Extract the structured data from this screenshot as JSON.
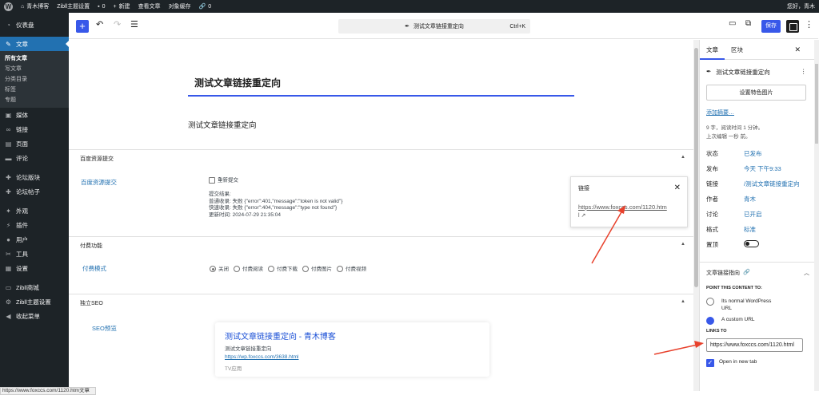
{
  "adminbar": {
    "site": "青木博客",
    "zibll_settings": "Zibll主题设置",
    "comments": "0",
    "new": "新建",
    "view": "查看文章",
    "cache": "对象缓存",
    "links_count": "0",
    "greeting": "您好，青木"
  },
  "sidebar": {
    "items": [
      {
        "label": "仪表盘",
        "icon": "dashboard-icon"
      },
      {
        "label": "文章",
        "icon": "pin-icon"
      },
      {
        "label": "媒体",
        "icon": "media-icon"
      },
      {
        "label": "链接",
        "icon": "link-icon"
      },
      {
        "label": "页面",
        "icon": "page-icon"
      },
      {
        "label": "评论",
        "icon": "comment-icon"
      },
      {
        "label": "论坛版块",
        "icon": "forum-icon"
      },
      {
        "label": "论坛帖子",
        "icon": "forum-post-icon"
      },
      {
        "label": "外观",
        "icon": "appearance-icon"
      },
      {
        "label": "插件",
        "icon": "plugin-icon"
      },
      {
        "label": "用户",
        "icon": "user-icon"
      },
      {
        "label": "工具",
        "icon": "tools-icon"
      },
      {
        "label": "设置",
        "icon": "settings-icon"
      },
      {
        "label": "Zibll商城",
        "icon": "shop-icon"
      },
      {
        "label": "Zibll主题设置",
        "icon": "gear-icon"
      },
      {
        "label": "收起菜单",
        "icon": "collapse-icon"
      }
    ],
    "sub": [
      "所有文章",
      "写文章",
      "分类目录",
      "标签",
      "专题"
    ]
  },
  "toolbar": {
    "command": "测试文章链接重定向",
    "shortcut": "Ctrl+K",
    "save": "保存"
  },
  "editor": {
    "title": "测试文章链接重定向",
    "paragraph": "测试文章链接重定向"
  },
  "baidu": {
    "header": "百度资源提交",
    "label": "百度资源提交",
    "resubmit": "重新提交",
    "result_title": "提交结果:",
    "normal": "普通收录: 失败 {\"error\":401,\"message\":\"token is not valid\"}",
    "fast": "快速收录: 失败 {\"error\":404,\"message\":\"type not found\"}",
    "time": "更新时间: 2024-07-29 21:35:04"
  },
  "paid": {
    "header": "付费功能",
    "label": "付费模式",
    "options": [
      "关闭",
      "付费阅读",
      "付费下载",
      "付费图片",
      "付费视频"
    ]
  },
  "seo": {
    "header": "独立SEO",
    "label": "SEO预览",
    "preview_title": "测试文章链接重定向 - 青木博客",
    "preview_desc": "测试文章链接重定向",
    "preview_url": "https://wp.foxccs.com/3638.html",
    "preview_tag": "TV应用"
  },
  "link_popover": {
    "title": "链接",
    "url": "https://www.foxccs.com/1120.htm",
    "tail": "l ↗"
  },
  "panel": {
    "tab_post": "文章",
    "tab_block": "区块",
    "post_title": "测试文章链接重定向",
    "featured": "设置特色图片",
    "excerpt": "添加摘要…",
    "stats": "9 字，阅读时间 1 分钟。",
    "edited": "上次编辑 一秒 前。",
    "rows": [
      {
        "k": "状态",
        "v": "已发布"
      },
      {
        "k": "发布",
        "v": "今天 下午9:33"
      },
      {
        "k": "链接",
        "v": "/测试文章链接重定向"
      },
      {
        "k": "作者",
        "v": "青木"
      },
      {
        "k": "讨论",
        "v": "已开启"
      },
      {
        "k": "格式",
        "v": "标准"
      },
      {
        "k": "置顶",
        "v": ""
      }
    ],
    "redirect_title": "文章链接指向",
    "point": "POINT THIS CONTENT TO:",
    "opt1": "Its normal WordPress URL",
    "opt2": "A custom URL",
    "links_to": "LINKS TO",
    "url": "https://www.foxccs.com/1120.html",
    "newtab": "Open in new tab"
  },
  "statusbar": {
    "text": "https://www.foxccs.com/1120.htm文章"
  },
  "colors": {
    "accent": "#3858e9",
    "admin_dark": "#1d2327",
    "arrow": "#e8412c"
  }
}
